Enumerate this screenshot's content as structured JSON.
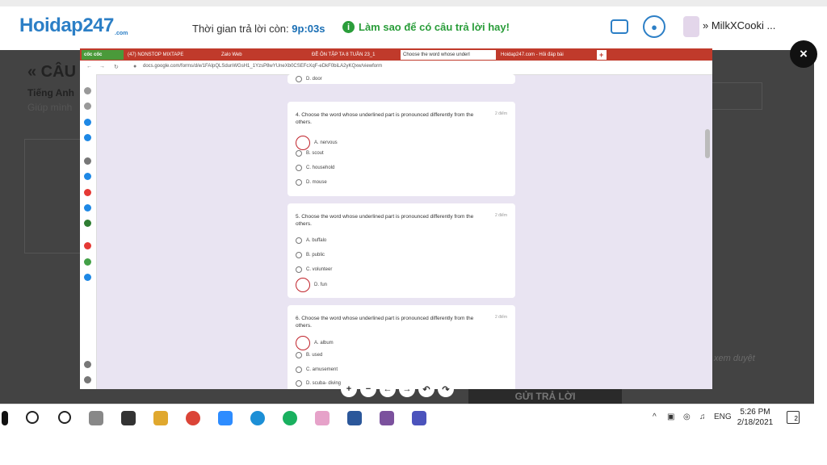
{
  "header": {
    "logo": "Hoidap247",
    "logo_com": ".com",
    "timer_label": "Thời gian trả lời còn:",
    "timer_value": "9p:03s",
    "tip": "Làm sao để có câu trả lời hay!",
    "username": "MilkXCooki ..."
  },
  "page": {
    "title": "« CÂU",
    "subject": "Tiếng Anh",
    "helper_text": "Giúp mình",
    "pending_text": "xem duyệt",
    "submit_label": "GỬI TRẢ LỜI",
    "close_label": "×"
  },
  "browser": {
    "brand_tab": "cốc cốc",
    "tabs": [
      "(47) NONSTOP MIXTAPE",
      "Zalo Web",
      "ĐỀ ÔN TẬP TA 8 TUẦN 23_1",
      "Choose the word whose underl",
      "Hoidap247.com - Hỏi đáp bài"
    ],
    "url": "docs.google.com/forms/d/e/1FAIpQLSdunWGsH1_1YzsP8wYUneXb0CSEFcXqF-eDkF0biLA2yKQxw/viewform"
  },
  "form": {
    "top_option": "D. door",
    "questions": [
      {
        "text": "4. Choose the word whose underlined part is pronounced differently from the others.",
        "points": "2 điểm",
        "options": [
          "A. nervous",
          "B. scout",
          "C. household",
          "D. mouse"
        ]
      },
      {
        "text": "5. Choose the word whose underlined part is pronounced differently from the others.",
        "points": "2 điểm",
        "options": [
          "A. buffalo",
          "B. public",
          "C. volunteer",
          "D. fun"
        ]
      },
      {
        "text": "6. Choose the word whose underlined part is pronounced differently from the others.",
        "points": "2 điểm",
        "options": [
          "A. album",
          "B. used",
          "C. amusement",
          "D. scuba- diving"
        ]
      }
    ]
  },
  "taskbar": {
    "lang": "ENG",
    "time": "5:26 PM",
    "date": "2/18/2021",
    "notif_count": "2"
  }
}
